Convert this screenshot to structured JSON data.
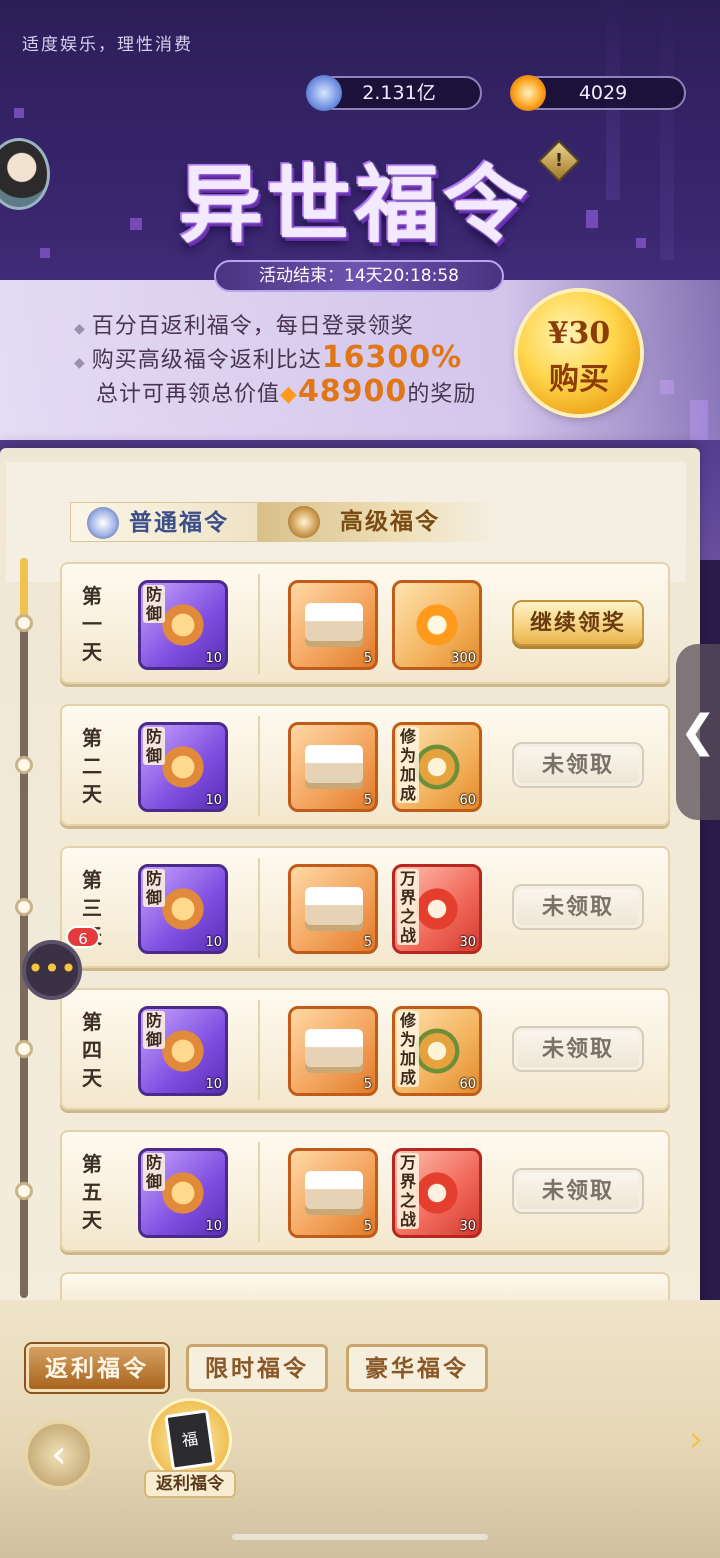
{
  "notice": "适度娱乐，理性消费",
  "resources": [
    {
      "icon": "spirit-jade-icon",
      "value": "2.131亿"
    },
    {
      "icon": "gold-flame-icon",
      "value": "4029"
    }
  ],
  "title": "异世福令",
  "info_icon": "!",
  "timer": "活动结束：14天20:18:58",
  "banner": {
    "line1": "百分百返利福令，每日登录领奖",
    "line2_prefix": "购买高级福令返利比达",
    "line2_value": "16300%",
    "line3_prefix": "总计可再领总价值",
    "line3_value": "48900",
    "line3_suffix": "的奖励"
  },
  "buy_button": {
    "price": "¥30",
    "label": "购买"
  },
  "tabs": {
    "normal": "普通福令",
    "premium": "高级福令"
  },
  "rows": [
    {
      "day": "第一天",
      "normal": {
        "tag": "防御",
        "qty": "10"
      },
      "p1": {
        "qty": "5"
      },
      "p2": {
        "tag": "",
        "qty": "300",
        "kind": "coin"
      },
      "button": "继续领奖",
      "state": "claim"
    },
    {
      "day": "第二天",
      "normal": {
        "tag": "防御",
        "qty": "10"
      },
      "p1": {
        "qty": "5"
      },
      "p2": {
        "tag": "修为加成",
        "qty": "60",
        "kind": "cup"
      },
      "button": "未领取",
      "state": "locked"
    },
    {
      "day": "第三天",
      "normal": {
        "tag": "防御",
        "qty": "10"
      },
      "p1": {
        "qty": "5"
      },
      "p2": {
        "tag": "万界之战",
        "qty": "30",
        "kind": "red"
      },
      "button": "未领取",
      "state": "locked"
    },
    {
      "day": "第四天",
      "normal": {
        "tag": "防御",
        "qty": "10"
      },
      "p1": {
        "qty": "5"
      },
      "p2": {
        "tag": "修为加成",
        "qty": "60",
        "kind": "cup"
      },
      "button": "未领取",
      "state": "locked"
    },
    {
      "day": "第五天",
      "normal": {
        "tag": "防御",
        "qty": "10"
      },
      "p1": {
        "qty": "5"
      },
      "p2": {
        "tag": "万界之战",
        "qty": "30",
        "kind": "red"
      },
      "button": "未领取",
      "state": "locked"
    }
  ],
  "chat_badge": "6",
  "side_handle": "❮",
  "footer_tabs": [
    "返利福令",
    "限时福令",
    "豪华福令"
  ],
  "hub_label": "返利福令",
  "hub_book_char": "福",
  "back_icon": "‹",
  "next_icon": "›"
}
